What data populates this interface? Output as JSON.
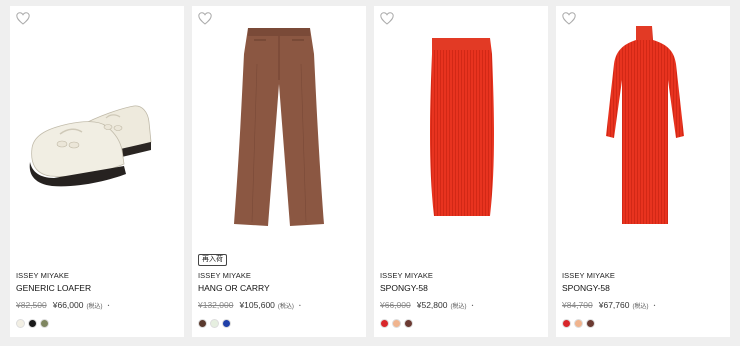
{
  "products": [
    {
      "brand": "ISSEY MIYAKE",
      "name": "GENERIC LOAFER",
      "original_price": "¥82,500",
      "sale_price": "¥66,000",
      "tax_label": "(税込)",
      "badge": "",
      "colors": [
        "#f2efe4",
        "#1a1a1a",
        "#7f8660"
      ]
    },
    {
      "brand": "ISSEY MIYAKE",
      "name": "HANG OR CARRY",
      "original_price": "¥132,000",
      "sale_price": "¥105,600",
      "tax_label": "(税込)",
      "badge": "再入荷",
      "colors": [
        "#5a3a2e",
        "#e6efe0",
        "#1f3fa8"
      ]
    },
    {
      "brand": "ISSEY MIYAKE",
      "name": "SPONGY-58",
      "original_price": "¥66,000",
      "sale_price": "¥52,800",
      "tax_label": "(税込)",
      "badge": "",
      "colors": [
        "#d8262a",
        "#f0b48e",
        "#6b3a32"
      ]
    },
    {
      "brand": "ISSEY MIYAKE",
      "name": "SPONGY-58",
      "original_price": "¥84,700",
      "sale_price": "¥67,760",
      "tax_label": "(税込)",
      "badge": "",
      "colors": [
        "#d8262a",
        "#f0b48e",
        "#6b3a32"
      ]
    }
  ],
  "icons": {
    "favorite": "heart-outline-icon"
  }
}
